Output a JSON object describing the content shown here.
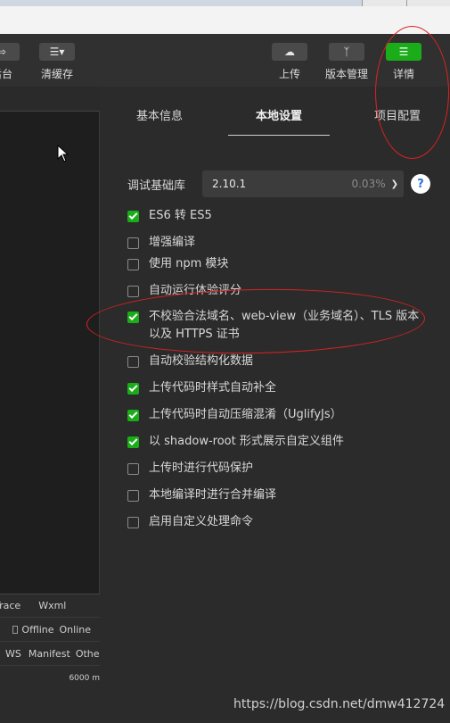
{
  "toolbar": {
    "left_items": [
      {
        "label": "后台",
        "icon": "console-icon"
      },
      {
        "label": "清缓存",
        "icon": "layers-icon"
      }
    ],
    "right_items": [
      {
        "label": "上传",
        "icon": "cloud-upload-icon"
      },
      {
        "label": "版本管理",
        "icon": "branch-icon"
      },
      {
        "label": "详情",
        "icon": "menu-icon"
      }
    ]
  },
  "left_bottom": {
    "tabs_row1": [
      "Trace",
      "Wxml"
    ],
    "network_options": [
      "Offline",
      "Online"
    ],
    "tabs_row3": [
      "WS",
      "Manifest",
      "Other"
    ],
    "timeline_label": "6000 m"
  },
  "settings": {
    "tabs": [
      "基本信息",
      "本地设置",
      "项目配置"
    ],
    "active_tab": "本地设置",
    "debug_lib_label": "调试基础库",
    "debug_lib_version": "2.10.1",
    "debug_lib_percent": "0.03%",
    "help_label": "?",
    "options": [
      {
        "label": "ES6 转 ES5",
        "checked": true
      },
      {
        "label": "增强编译",
        "checked": false
      },
      {
        "label": "使用 npm 模块",
        "checked": false
      },
      {
        "label": "自动运行体验评分",
        "checked": false
      },
      {
        "label": "不校验合法域名、web-view（业务域名）、TLS 版本以及 HTTPS 证书",
        "checked": true
      },
      {
        "label": "自动校验结构化数据",
        "checked": false
      },
      {
        "label": "上传代码时样式自动补全",
        "checked": true
      },
      {
        "label": "上传代码时自动压缩混淆（UglifyJs）",
        "checked": true
      },
      {
        "label": "以 shadow-root 形式展示自定义组件",
        "checked": true
      },
      {
        "label": "上传时进行代码保护",
        "checked": false
      },
      {
        "label": "本地编译时进行合并编译",
        "checked": false
      },
      {
        "label": "启用自定义处理命令",
        "checked": false
      }
    ]
  },
  "watermark": "https://blog.csdn.net/dmw412724",
  "colors": {
    "accent": "#1aad19",
    "annotation": "#dd2222",
    "panel_bg": "#2b2b2b"
  }
}
